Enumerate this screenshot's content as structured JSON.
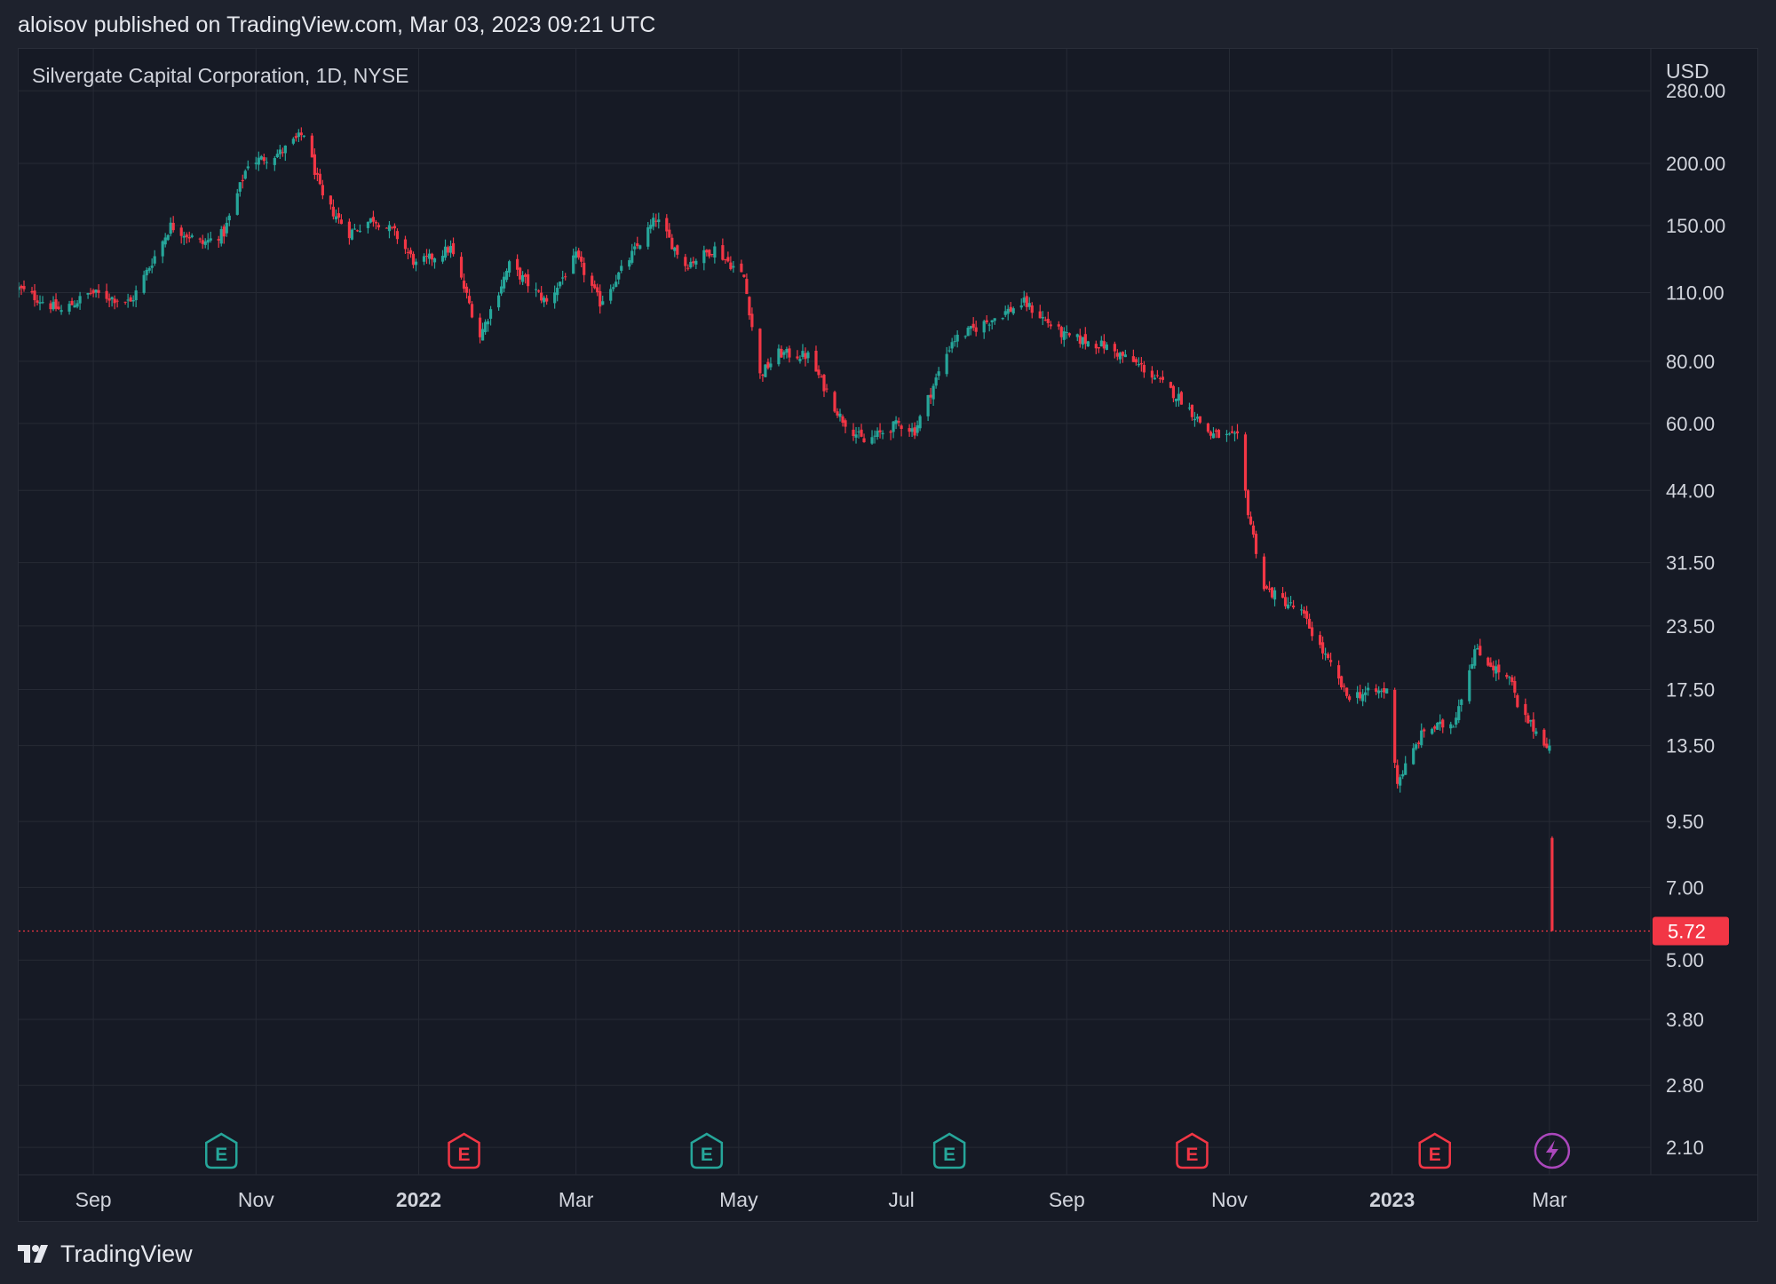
{
  "header": {
    "published_line": "aloisov published on TradingView.com, Mar 03, 2023 09:21 UTC"
  },
  "footer": {
    "brand": "TradingView"
  },
  "colors": {
    "background": "#161a25",
    "page": "#1e222d",
    "grid": "#262a35",
    "up": "#26a69a",
    "down": "#f23645",
    "text": "#d1d4dc",
    "volatility_event": "#ab47bc"
  },
  "chart_data": {
    "type": "candlestick",
    "title": "Silvergate Capital Corporation, 1D, NYSE",
    "symbol": "Silvergate Capital Corporation",
    "interval": "1D",
    "exchange": "NYSE",
    "currency": "USD",
    "scale": "log",
    "grid": true,
    "y_ticks": [
      "280.00",
      "200.00",
      "150.00",
      "110.00",
      "80.00",
      "60.00",
      "44.00",
      "31.50",
      "23.50",
      "17.50",
      "13.50",
      "9.50",
      "7.00",
      "5.00",
      "3.80",
      "2.80",
      "2.10"
    ],
    "y_range": [
      1.85,
      340
    ],
    "x_range": [
      "2021-08-04",
      "2023-04-08"
    ],
    "x_ticks": [
      {
        "label": "Sep",
        "date": "2021-09-01",
        "bold": false
      },
      {
        "label": "Nov",
        "date": "2021-11-01",
        "bold": false
      },
      {
        "label": "2022",
        "date": "2022-01-01",
        "bold": true
      },
      {
        "label": "Mar",
        "date": "2022-03-01",
        "bold": false
      },
      {
        "label": "May",
        "date": "2022-05-01",
        "bold": false
      },
      {
        "label": "Jul",
        "date": "2022-07-01",
        "bold": false
      },
      {
        "label": "Sep",
        "date": "2022-09-01",
        "bold": false
      },
      {
        "label": "Nov",
        "date": "2022-11-01",
        "bold": false
      },
      {
        "label": "2023",
        "date": "2023-01-01",
        "bold": true
      },
      {
        "label": "Mar",
        "date": "2023-03-01",
        "bold": false
      }
    ],
    "last_price": "5.72",
    "last_price_value": 5.72,
    "events": [
      {
        "type": "earnings",
        "label": "E",
        "date": "2021-10-19",
        "result": "up"
      },
      {
        "type": "earnings",
        "label": "E",
        "date": "2022-01-18",
        "result": "down"
      },
      {
        "type": "earnings",
        "label": "E",
        "date": "2022-04-19",
        "result": "up"
      },
      {
        "type": "earnings",
        "label": "E",
        "date": "2022-07-19",
        "result": "up"
      },
      {
        "type": "earnings",
        "label": "E",
        "date": "2022-10-18",
        "result": "down"
      },
      {
        "type": "earnings",
        "label": "E",
        "date": "2023-01-17",
        "result": "down"
      },
      {
        "type": "dividend_split_event",
        "label": "⚡",
        "date": "2023-03-02",
        "result": "event"
      }
    ],
    "price_anchors": [
      [
        "2021-08-04",
        112
      ],
      [
        "2021-08-20",
        101
      ],
      [
        "2021-08-31",
        110
      ],
      [
        "2021-09-15",
        105
      ],
      [
        "2021-09-30",
        150
      ],
      [
        "2021-10-12",
        138
      ],
      [
        "2021-10-20",
        145
      ],
      [
        "2021-10-29",
        200
      ],
      [
        "2021-11-10",
        210
      ],
      [
        "2021-11-19",
        230
      ],
      [
        "2021-11-26",
        170
      ],
      [
        "2021-12-06",
        145
      ],
      [
        "2021-12-15",
        155
      ],
      [
        "2021-12-23",
        145
      ],
      [
        "2021-12-31",
        125
      ],
      [
        "2022-01-13",
        135
      ],
      [
        "2022-01-24",
        90
      ],
      [
        "2022-02-04",
        125
      ],
      [
        "2022-02-18",
        105
      ],
      [
        "2022-03-01",
        130
      ],
      [
        "2022-03-10",
        105
      ],
      [
        "2022-03-31",
        155
      ],
      [
        "2022-04-11",
        125
      ],
      [
        "2022-04-22",
        135
      ],
      [
        "2022-05-03",
        118
      ],
      [
        "2022-05-09",
        75
      ],
      [
        "2022-05-16",
        83
      ],
      [
        "2022-05-27",
        82
      ],
      [
        "2022-06-08",
        62
      ],
      [
        "2022-06-17",
        55
      ],
      [
        "2022-06-30",
        60
      ],
      [
        "2022-07-06",
        58
      ],
      [
        "2022-07-20",
        88
      ],
      [
        "2022-08-05",
        98
      ],
      [
        "2022-08-16",
        105
      ],
      [
        "2022-08-31",
        90
      ],
      [
        "2022-09-15",
        86
      ],
      [
        "2022-09-29",
        78
      ],
      [
        "2022-10-14",
        67
      ],
      [
        "2022-10-25",
        57
      ],
      [
        "2022-11-04",
        56
      ],
      [
        "2022-11-08",
        40
      ],
      [
        "2022-11-14",
        28
      ],
      [
        "2022-11-28",
        25
      ],
      [
        "2022-12-15",
        17
      ],
      [
        "2022-12-30",
        17.4
      ],
      [
        "2023-01-03",
        11.4
      ],
      [
        "2023-01-13",
        14.5
      ],
      [
        "2023-01-24",
        15
      ],
      [
        "2023-02-01",
        21
      ],
      [
        "2023-02-15",
        18
      ],
      [
        "2023-02-17",
        16
      ],
      [
        "2023-02-28",
        13.6
      ],
      [
        "2023-03-01",
        13.4
      ],
      [
        "2023-03-02",
        5.72
      ]
    ]
  }
}
